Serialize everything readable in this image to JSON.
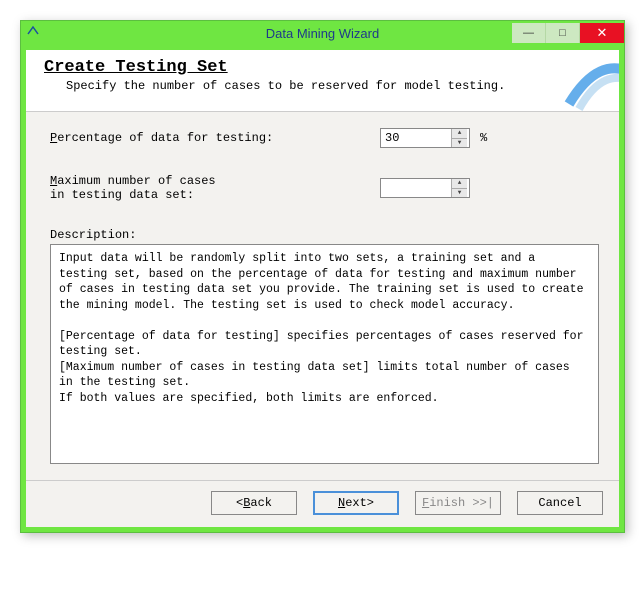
{
  "titlebar": {
    "title": "Data Mining Wizard",
    "min": "—",
    "max": "□",
    "close": "✕"
  },
  "header": {
    "title": "Create Testing Set",
    "subtitle": "Specify the number of cases to be reserved for model testing."
  },
  "form": {
    "percentage": {
      "prefix": "P",
      "rest": "ercentage of data for testing:",
      "value": "30",
      "unit": "%"
    },
    "maxcases": {
      "prefix": "M",
      "line1_rest": "aximum number of cases",
      "line2": "in testing data set:",
      "value": ""
    }
  },
  "description": {
    "label_prefix": "D",
    "label_rest": "escription:",
    "text": "Input data will be randomly split into two sets, a training set and a testing set, based on the percentage of data for testing and maximum number of cases in testing data set you provide. The training set is used to create the mining model. The testing set is used to check model accuracy.\n\n[Percentage of data for testing] specifies percentages of cases reserved for testing set.\n[Maximum number of cases in testing data set] limits total number of cases in the testing set.\nIf both values are specified, both limits are enforced."
  },
  "buttons": {
    "back_u": "B",
    "back_rest": "ack",
    "next_u": "N",
    "next_rest": "ext",
    "finish_u": "F",
    "finish_rest": "inish >>|",
    "cancel": "Cancel"
  }
}
